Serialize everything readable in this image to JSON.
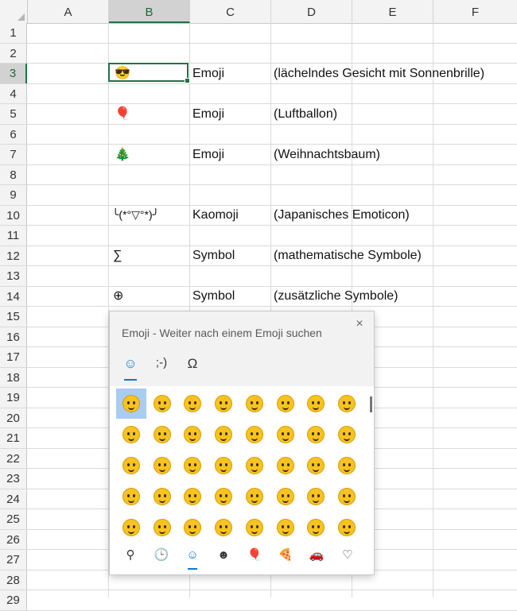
{
  "columns": [
    "A",
    "B",
    "C",
    "D",
    "E",
    "F"
  ],
  "rows": [
    "1",
    "2",
    "3",
    "4",
    "5",
    "6",
    "7",
    "8",
    "9",
    "10",
    "11",
    "12",
    "13",
    "14",
    "15",
    "16",
    "17",
    "18",
    "19",
    "20",
    "21",
    "22",
    "23",
    "24",
    "25",
    "26",
    "27",
    "28",
    "29"
  ],
  "cells": {
    "b3": "😎",
    "c3": "Emoji",
    "d3": "(lächelndes Gesicht mit Sonnenbrille)",
    "b5": "🎈",
    "c5": "Emoji",
    "d5": "(Luftballon)",
    "b7": "🎄",
    "c7": "Emoji",
    "d7": "(Weihnachtsbaum)",
    "b10": "╰(*°▽°*)╯",
    "c10": "Kaomoji",
    "d10": "(Japanisches Emoticon)",
    "b12": "∑",
    "c12": "Symbol",
    "d12": "(mathematische Symbole)",
    "b14": "⊕",
    "c14": "Symbol",
    "d14": "(zusätzliche Symbole)"
  },
  "panel": {
    "title": "Emoji - Weiter nach einem Emoji suchen",
    "close": "×",
    "tabs": [
      "☺",
      ";-)",
      "Ω"
    ],
    "emojis": [
      "😀",
      "😁",
      "😂",
      "🤣",
      "😃",
      "😄",
      "😅",
      "😆",
      "😉",
      "😊",
      "😋",
      "😎",
      "😍",
      "😘",
      "🥰",
      "😗",
      "😙",
      "😚",
      "☺",
      "🙂",
      "🤗",
      "🤩",
      "🤔",
      "🤨",
      "😐",
      "😑",
      "😶",
      "🙄",
      "😏",
      "😣",
      "😥",
      "😮",
      "🤐",
      "😯",
      "😪",
      "😫",
      "🤫",
      "😴",
      "😌",
      "😛"
    ],
    "categories": [
      "search",
      "recent",
      "smiley",
      "people",
      "balloon",
      "pizza",
      "car",
      "heart"
    ],
    "category_glyphs": [
      "⚲",
      "🕒",
      "☺",
      "☻",
      "🎈",
      "🍕",
      "🚗",
      "♡"
    ]
  },
  "colors": {
    "accent": "#217346",
    "panel_accent": "#0a7ad1"
  }
}
